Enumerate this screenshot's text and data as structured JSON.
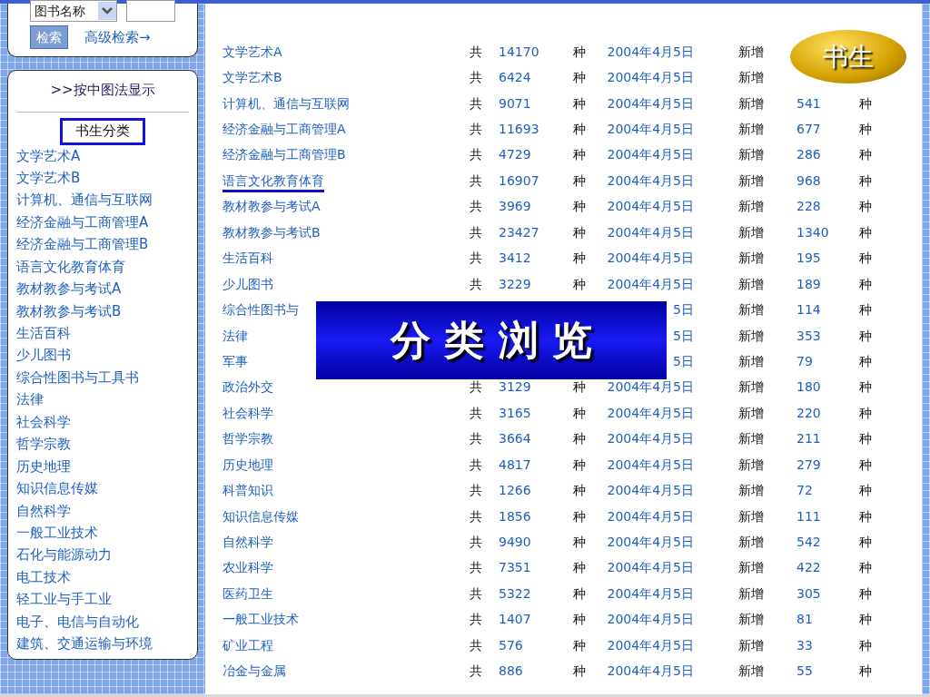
{
  "search": {
    "field_select": "图书名称",
    "button": "检索",
    "advanced_link": "高级检索→"
  },
  "sidebar": {
    "mode_link": ">>按中图法显示",
    "heading": "书生分类",
    "items": [
      {
        "label": "文学艺术A"
      },
      {
        "label": "文学艺术B"
      },
      {
        "label": "计算机、通信与互联网"
      },
      {
        "label": "经济金融与工商管理A"
      },
      {
        "label": "经济金融与工商管理B"
      },
      {
        "label": "语言文化教育体育"
      },
      {
        "label": "教材教参与考试A"
      },
      {
        "label": "教材教参与考试B"
      },
      {
        "label": "生活百科"
      },
      {
        "label": "少儿图书"
      },
      {
        "label": "综合性图书与工具书"
      },
      {
        "label": "法律"
      },
      {
        "label": "社会科学"
      },
      {
        "label": "哲学宗教"
      },
      {
        "label": "历史地理"
      },
      {
        "label": "知识信息传媒"
      },
      {
        "label": "自然科学"
      },
      {
        "label": "一般工业技术"
      },
      {
        "label": "石化与能源动力"
      },
      {
        "label": "电工技术"
      },
      {
        "label": "轻工业与手工业"
      },
      {
        "label": "电子、电信与自动化"
      },
      {
        "label": "建筑、交通运输与环境"
      }
    ]
  },
  "rows": [
    {
      "name": "文学艺术A",
      "total_prefix": "共",
      "total": "14170",
      "total_unit": "种",
      "date": "2004年4月5日",
      "new_prefix": "新增",
      "underlined": false
    },
    {
      "name": "文学艺术B",
      "total_prefix": "共",
      "total": "6424",
      "total_unit": "种",
      "date": "2004年4月5日",
      "new_prefix": "新增",
      "underlined": false
    },
    {
      "name": "计算机、通信与互联网",
      "total_prefix": "共",
      "total": "9071",
      "total_unit": "种",
      "date": "2004年4月5日",
      "new_prefix": "新增",
      "new": "541",
      "new_unit": "种",
      "underlined": false
    },
    {
      "name": "经济金融与工商管理A",
      "total_prefix": "共",
      "total": "11693",
      "total_unit": "种",
      "date": "2004年4月5日",
      "new_prefix": "新增",
      "new": "677",
      "new_unit": "种",
      "underlined": false
    },
    {
      "name": "经济金融与工商管理B",
      "total_prefix": "共",
      "total": "4729",
      "total_unit": "种",
      "date": "2004年4月5日",
      "new_prefix": "新增",
      "new": "286",
      "new_unit": "种",
      "underlined": false
    },
    {
      "name": "语言文化教育体育",
      "total_prefix": "共",
      "total": "16907",
      "total_unit": "种",
      "date": "2004年4月5日",
      "new_prefix": "新增",
      "new": "968",
      "new_unit": "种",
      "underlined": true
    },
    {
      "name": "教材教参与考试A",
      "total_prefix": "共",
      "total": "3969",
      "total_unit": "种",
      "date": "2004年4月5日",
      "new_prefix": "新增",
      "new": "228",
      "new_unit": "种",
      "underlined": false
    },
    {
      "name": "教材教参与考试B",
      "total_prefix": "共",
      "total": "23427",
      "total_unit": "种",
      "date": "2004年4月5日",
      "new_prefix": "新增",
      "new": "1340",
      "new_unit": "种",
      "underlined": false
    },
    {
      "name": "生活百科",
      "total_prefix": "共",
      "total": "3412",
      "total_unit": "种",
      "date": "2004年4月5日",
      "new_prefix": "新增",
      "new": "195",
      "new_unit": "种",
      "underlined": false
    },
    {
      "name": "少儿图书",
      "total_prefix": "共",
      "total": "3229",
      "total_unit": "种",
      "date": "2004年4月5日",
      "new_prefix": "新增",
      "new": "189",
      "new_unit": "种",
      "underlined": false
    },
    {
      "name": "综合性图书与",
      "date": "5日",
      "new_prefix": "新增",
      "new": "114",
      "new_unit": "种",
      "underlined": false
    },
    {
      "name": "法律",
      "date": "5日",
      "new_prefix": "新增",
      "new": "353",
      "new_unit": "种",
      "underlined": false
    },
    {
      "name": "军事",
      "date": "5日",
      "new_prefix": "新增",
      "new": "79",
      "new_unit": "种",
      "underlined": false
    },
    {
      "name": "政治外交",
      "total_prefix": "共",
      "total": "3129",
      "total_unit": "种",
      "date": "2004年4月5日",
      "new_prefix": "新增",
      "new": "180",
      "new_unit": "种",
      "underlined": false
    },
    {
      "name": "社会科学",
      "total_prefix": "共",
      "total": "3165",
      "total_unit": "种",
      "date": "2004年4月5日",
      "new_prefix": "新增",
      "new": "220",
      "new_unit": "种",
      "underlined": false
    },
    {
      "name": "哲学宗教",
      "total_prefix": "共",
      "total": "3664",
      "total_unit": "种",
      "date": "2004年4月5日",
      "new_prefix": "新增",
      "new": "211",
      "new_unit": "种",
      "underlined": false
    },
    {
      "name": "历史地理",
      "total_prefix": "共",
      "total": "4817",
      "total_unit": "种",
      "date": "2004年4月5日",
      "new_prefix": "新增",
      "new": "279",
      "new_unit": "种",
      "underlined": false
    },
    {
      "name": "科普知识",
      "total_prefix": "共",
      "total": "1266",
      "total_unit": "种",
      "date": "2004年4月5日",
      "new_prefix": "新增",
      "new": "72",
      "new_unit": "种",
      "underlined": false
    },
    {
      "name": "知识信息传媒",
      "total_prefix": "共",
      "total": "1856",
      "total_unit": "种",
      "date": "2004年4月5日",
      "new_prefix": "新增",
      "new": "111",
      "new_unit": "种",
      "underlined": false
    },
    {
      "name": "自然科学",
      "total_prefix": "共",
      "total": "9490",
      "total_unit": "种",
      "date": "2004年4月5日",
      "new_prefix": "新增",
      "new": "542",
      "new_unit": "种",
      "underlined": false
    },
    {
      "name": "农业科学",
      "total_prefix": "共",
      "total": "7351",
      "total_unit": "种",
      "date": "2004年4月5日",
      "new_prefix": "新增",
      "new": "422",
      "new_unit": "种",
      "underlined": false
    },
    {
      "name": "医药卫生",
      "total_prefix": "共",
      "total": "5322",
      "total_unit": "种",
      "date": "2004年4月5日",
      "new_prefix": "新增",
      "new": "305",
      "new_unit": "种",
      "underlined": false
    },
    {
      "name": "一般工业技术",
      "total_prefix": "共",
      "total": "1407",
      "total_unit": "种",
      "date": "2004年4月5日",
      "new_prefix": "新增",
      "new": "81",
      "new_unit": "种",
      "underlined": false
    },
    {
      "name": "矿业工程",
      "total_prefix": "共",
      "total": "576",
      "total_unit": "种",
      "date": "2004年4月5日",
      "new_prefix": "新增",
      "new": "33",
      "new_unit": "种",
      "underlined": false
    },
    {
      "name": "冶金与金属",
      "total_prefix": "共",
      "total": "886",
      "total_unit": "种",
      "date": "2004年4月5日",
      "new_prefix": "新增",
      "new": "55",
      "new_unit": "种",
      "underlined": false
    }
  ],
  "badge": "书生",
  "banner": "分 类 浏 览"
}
